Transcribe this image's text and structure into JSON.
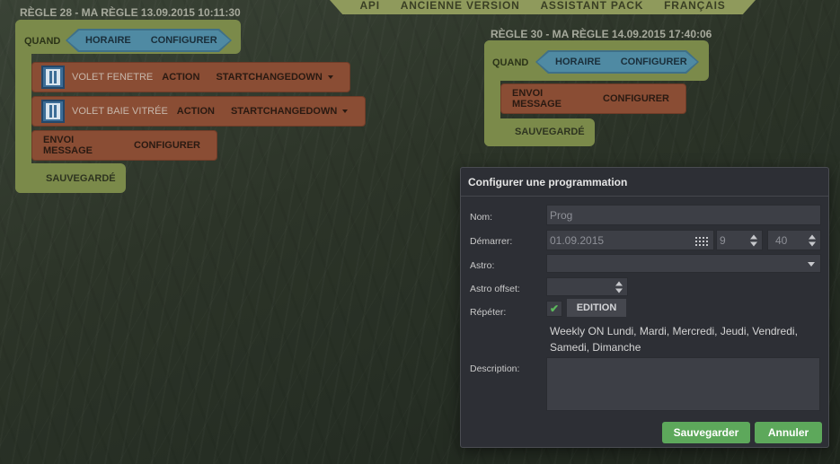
{
  "nav": {
    "items": [
      "API",
      "ANCIENNE VERSION",
      "ASSISTANT PACK",
      "FRANÇAIS"
    ]
  },
  "rule28": {
    "title": "RÈGLE 28 - MA RÈGLE 13.09.2015 10:11:30",
    "when_label": "QUAND",
    "condition": {
      "type": "HORAIRE",
      "configure": "CONFIGURER"
    },
    "actions": [
      {
        "device": "VOLET FENETRE",
        "keyword": "ACTION",
        "value": "STARTCHANGEDOWN",
        "icon": "shutter-icon"
      },
      {
        "device": "VOLET BAIE VITRÉE",
        "keyword": "ACTION",
        "value": "STARTCHANGEDOWN",
        "icon": "shutter-icon"
      },
      {
        "keyword": "ENVOI MESSAGE",
        "value": "CONFIGURER"
      }
    ],
    "status": "SAUVEGARDÉ"
  },
  "rule30": {
    "title": "RÈGLE 30 - MA RÈGLE 14.09.2015 17:40:06",
    "when_label": "QUAND",
    "condition": {
      "type": "HORAIRE",
      "configure": "CONFIGURER"
    },
    "actions": [
      {
        "keyword": "ENVOI MESSAGE",
        "value": "CONFIGURER"
      }
    ],
    "status": "SAUVEGARDÉ"
  },
  "dialog": {
    "title": "Configurer une programmation",
    "labels": {
      "name": "Nom:",
      "start": "Démarrer:",
      "astro": "Astro:",
      "astro_offset": "Astro offset:",
      "repeat": "Répéter:",
      "description": "Description:"
    },
    "name_value": "Prog",
    "start_date": "01.09.2015",
    "start_hour": "9",
    "start_minute": "40",
    "astro_value": "",
    "astro_offset_value": "",
    "repeat_checked": "✔",
    "edit_label": "EDITION",
    "repeat_text": "Weekly ON Lundi, Mardi, Mercredi, Jeudi, Vendredi, Samedi, Dimanche",
    "description_value": "",
    "save_label": "Sauvegarder",
    "cancel_label": "Annuler"
  },
  "colors": {
    "rule_bg": "#7b8a4a",
    "condition": "#4f8aa3",
    "action": "#8a4d34",
    "save_button": "#5da85b",
    "dialog_bg": "#2d2f35"
  }
}
